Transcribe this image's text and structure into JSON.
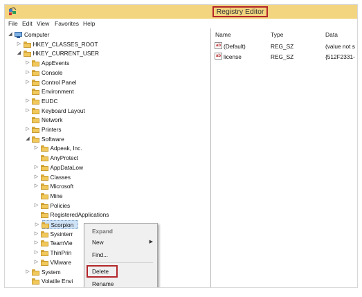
{
  "window": {
    "title": "Registry Editor"
  },
  "menu": [
    "File",
    "Edit",
    "View",
    "Favorites",
    "Help"
  ],
  "tree": [
    {
      "label": "Computer",
      "level": 0,
      "arrow": "expanded",
      "icon": "computer-icon"
    },
    {
      "label": "HKEY_CLASSES_ROOT",
      "level": 1,
      "arrow": "collapsed"
    },
    {
      "label": "HKEY_CURRENT_USER",
      "level": 1,
      "arrow": "expanded"
    },
    {
      "label": "AppEvents",
      "level": 2,
      "arrow": "collapsed"
    },
    {
      "label": "Console",
      "level": 2,
      "arrow": "collapsed"
    },
    {
      "label": "Control Panel",
      "level": 2,
      "arrow": "collapsed"
    },
    {
      "label": "Environment",
      "level": 2,
      "arrow": "none"
    },
    {
      "label": "EUDC",
      "level": 2,
      "arrow": "collapsed"
    },
    {
      "label": "Keyboard Layout",
      "level": 2,
      "arrow": "collapsed"
    },
    {
      "label": "Network",
      "level": 2,
      "arrow": "none"
    },
    {
      "label": "Printers",
      "level": 2,
      "arrow": "collapsed"
    },
    {
      "label": "Software",
      "level": 2,
      "arrow": "expanded"
    },
    {
      "label": "Adpeak, Inc.",
      "level": 3,
      "arrow": "collapsed"
    },
    {
      "label": "AnyProtect",
      "level": 3,
      "arrow": "none"
    },
    {
      "label": "AppDataLow",
      "level": 3,
      "arrow": "collapsed"
    },
    {
      "label": "Classes",
      "level": 3,
      "arrow": "collapsed"
    },
    {
      "label": "Microsoft",
      "level": 3,
      "arrow": "collapsed"
    },
    {
      "label": "Mine",
      "level": 3,
      "arrow": "none"
    },
    {
      "label": "Policies",
      "level": 3,
      "arrow": "collapsed"
    },
    {
      "label": "RegisteredApplications",
      "level": 3,
      "arrow": "none"
    },
    {
      "label": "Scorpion",
      "level": 3,
      "arrow": "collapsed",
      "selected": true
    },
    {
      "label": "Sysinterr",
      "level": 3,
      "arrow": "collapsed"
    },
    {
      "label": "TeamVie",
      "level": 3,
      "arrow": "collapsed"
    },
    {
      "label": "ThinPrin",
      "level": 3,
      "arrow": "collapsed"
    },
    {
      "label": "VMware",
      "level": 3,
      "arrow": "collapsed"
    },
    {
      "label": "System",
      "level": 2,
      "arrow": "collapsed"
    },
    {
      "label": "Volatile Envi",
      "level": 2,
      "arrow": "none"
    }
  ],
  "values_panel": {
    "columns": [
      "Name",
      "Type",
      "Data"
    ],
    "rows": [
      {
        "name": "(Default)",
        "type": "REG_SZ",
        "data": "(value not s"
      },
      {
        "name": "license",
        "type": "REG_SZ",
        "data": "{512F2331-"
      }
    ]
  },
  "context_menu": {
    "items": [
      {
        "label": "Expand",
        "disabled": true
      },
      {
        "label": "New",
        "submenu": true
      },
      {
        "label": "Find..."
      },
      {
        "separator": true
      },
      {
        "label": "Delete",
        "highlighted": true
      },
      {
        "label": "Rename"
      }
    ]
  },
  "colors": {
    "titlebar": "#f3d57f",
    "highlight_box": "#b3262a",
    "selection": "#cfe3f7"
  }
}
